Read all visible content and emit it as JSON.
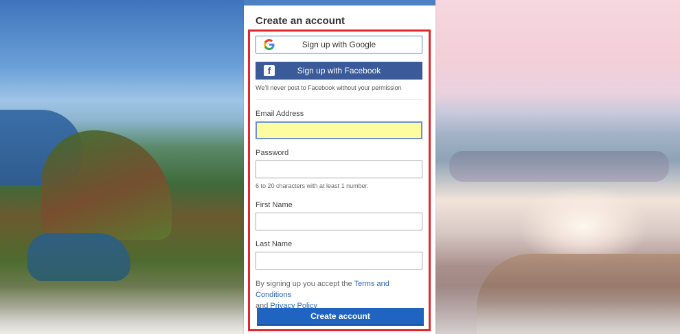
{
  "form": {
    "title": "Create an account",
    "google_button": "Sign up with Google",
    "facebook_button": "Sign up with Facebook",
    "facebook_note": "We'll never post to Facebook without your permission",
    "email_label": "Email Address",
    "email_value": "",
    "password_label": "Password",
    "password_hint": "6 to 20 characters with at least 1 number.",
    "firstname_label": "First Name",
    "lastname_label": "Last Name",
    "terms_prefix": "By signing up you accept the",
    "terms_link": "Terms and Conditions",
    "terms_and": "and",
    "privacy_link": "Privacy Policy",
    "create_button": "Create account"
  },
  "colors": {
    "highlight": "#e1262c",
    "facebook": "#3b5a9a",
    "primary": "#1f64c0",
    "focus_field": "#fdfca0",
    "link": "#2a66b8"
  },
  "icons": {
    "google": "google-icon",
    "facebook": "facebook-icon"
  }
}
